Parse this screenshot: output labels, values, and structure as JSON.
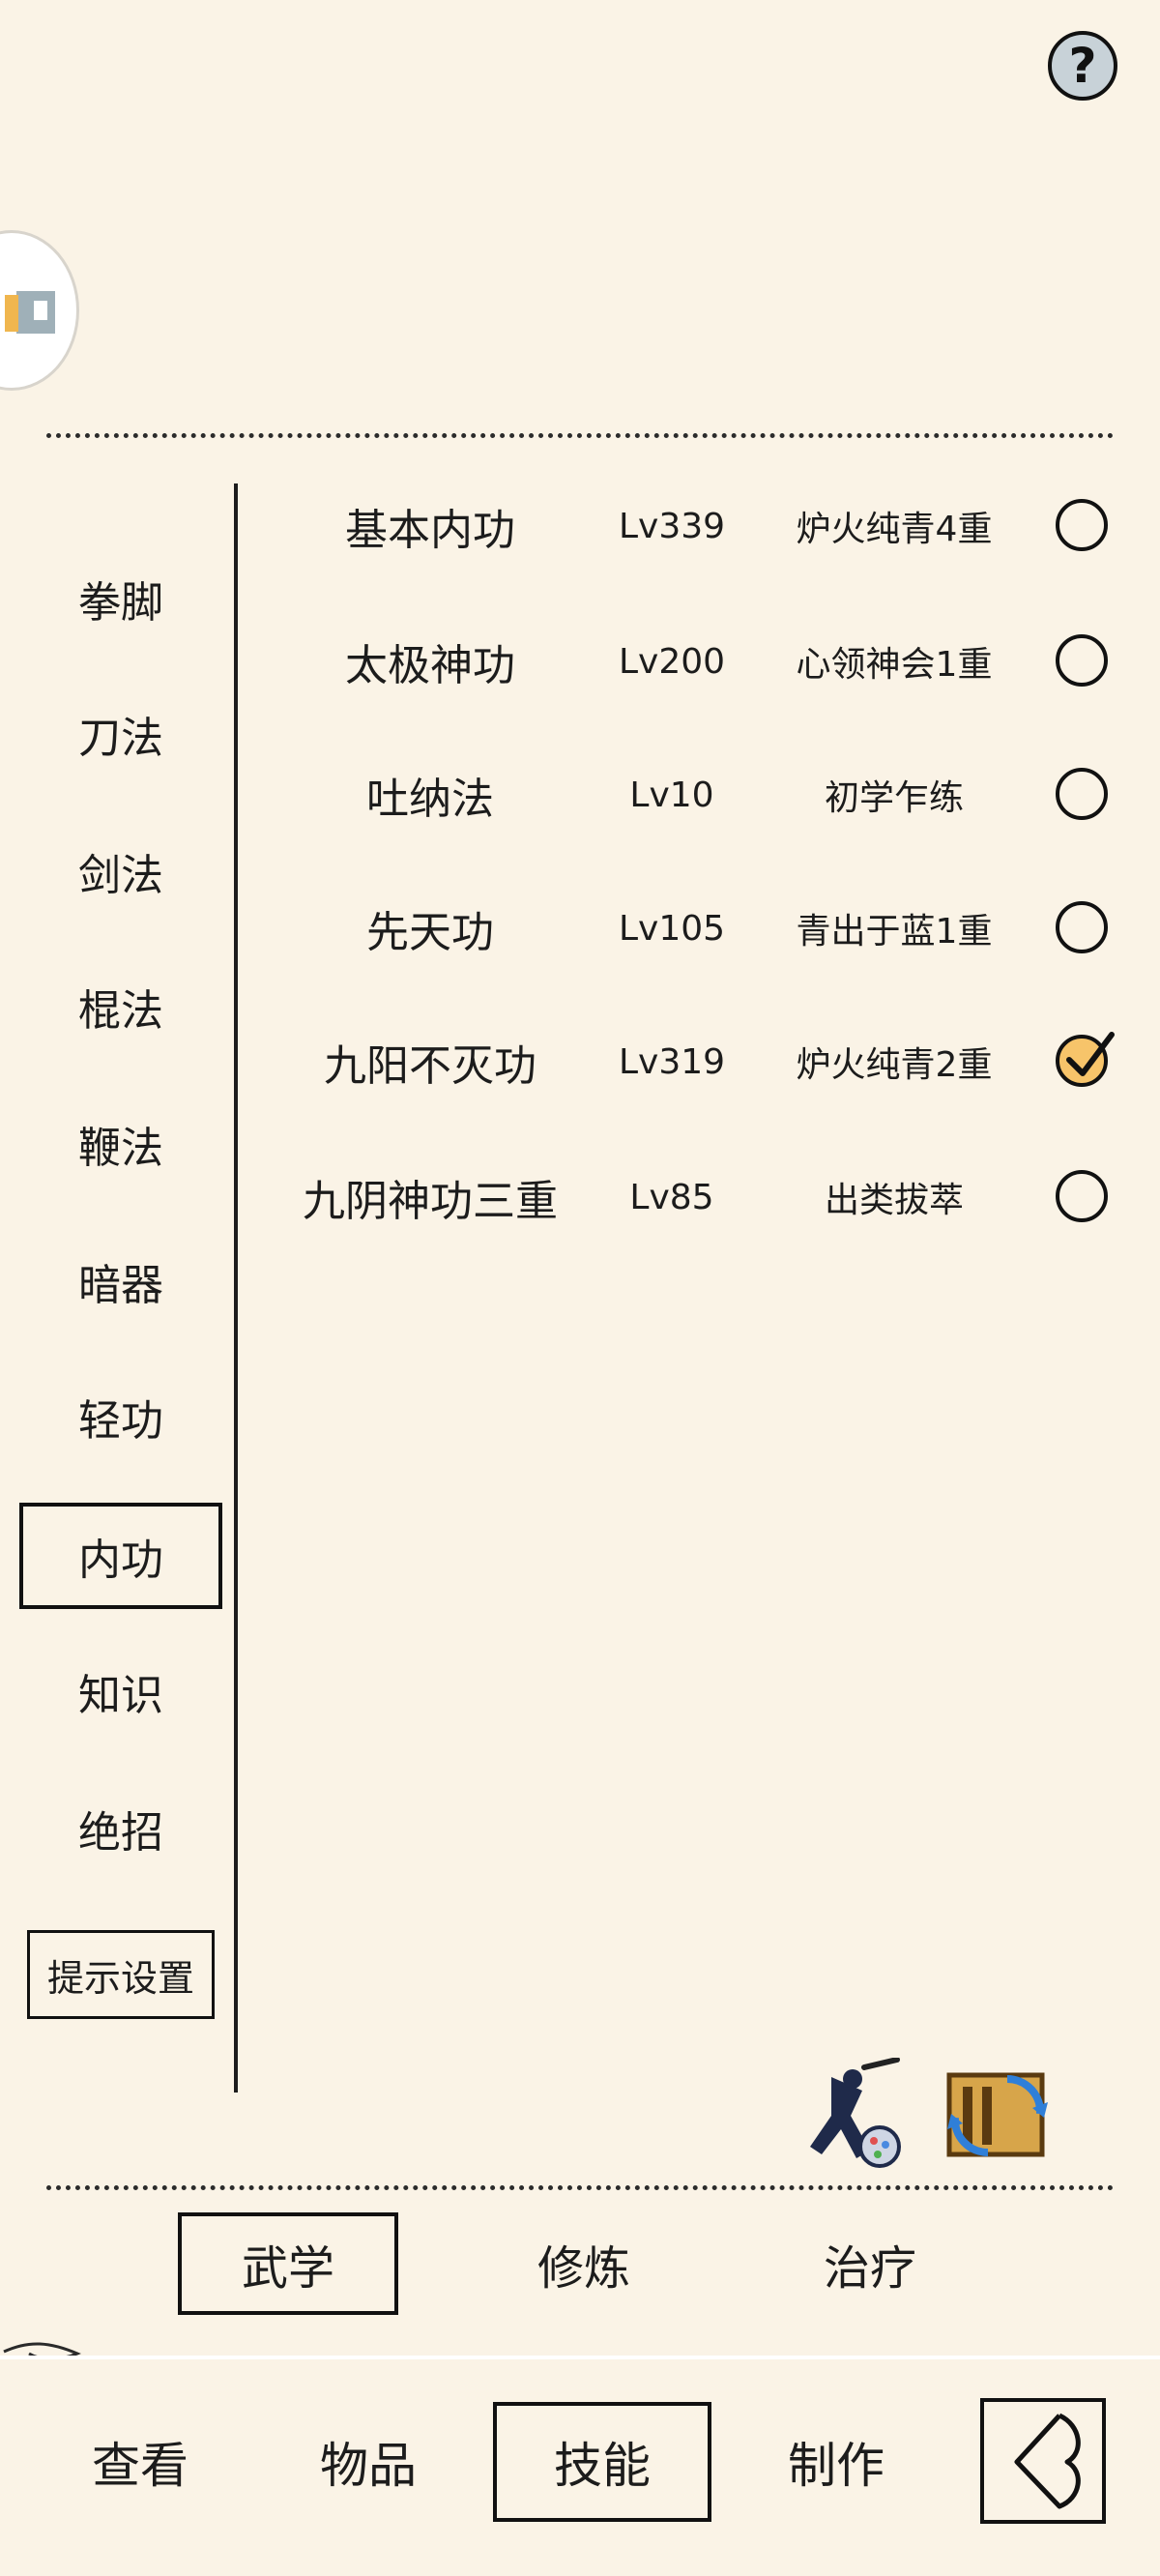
{
  "help": {
    "label": "?"
  },
  "categories": [
    {
      "label": "拳脚",
      "active": false
    },
    {
      "label": "刀法",
      "active": false
    },
    {
      "label": "剑法",
      "active": false
    },
    {
      "label": "棍法",
      "active": false
    },
    {
      "label": "鞭法",
      "active": false
    },
    {
      "label": "暗器",
      "active": false
    },
    {
      "label": "轻功",
      "active": false
    },
    {
      "label": "内功",
      "active": true
    },
    {
      "label": "知识",
      "active": false
    },
    {
      "label": "绝招",
      "active": false
    }
  ],
  "hint_settings_label": "提示设置",
  "skills": [
    {
      "name": "基本内功",
      "level": "Lv339",
      "stage": "炉火纯青4重",
      "selected": false
    },
    {
      "name": "太极神功",
      "level": "Lv200",
      "stage": "心领神会1重",
      "selected": false
    },
    {
      "name": "吐纳法",
      "level": "Lv10",
      "stage": "初学乍练",
      "selected": false
    },
    {
      "name": "先天功",
      "level": "Lv105",
      "stage": "青出于蓝1重",
      "selected": false
    },
    {
      "name": "九阳不灭功",
      "level": "Lv319",
      "stage": "炉火纯青2重",
      "selected": true
    },
    {
      "name": "九阴神功三重",
      "level": "Lv85",
      "stage": "出类拔萃",
      "selected": false
    }
  ],
  "subtabs": [
    {
      "label": "武学",
      "active": true
    },
    {
      "label": "修炼",
      "active": false
    },
    {
      "label": "治疗",
      "active": false
    }
  ],
  "nav": [
    {
      "label": "查看",
      "active": false
    },
    {
      "label": "物品",
      "active": false
    },
    {
      "label": "技能",
      "active": true
    },
    {
      "label": "制作",
      "active": false
    }
  ],
  "colors": {
    "background": "#faf3e6",
    "check_fill": "#f7c46a",
    "ink": "#1c1c1c"
  }
}
